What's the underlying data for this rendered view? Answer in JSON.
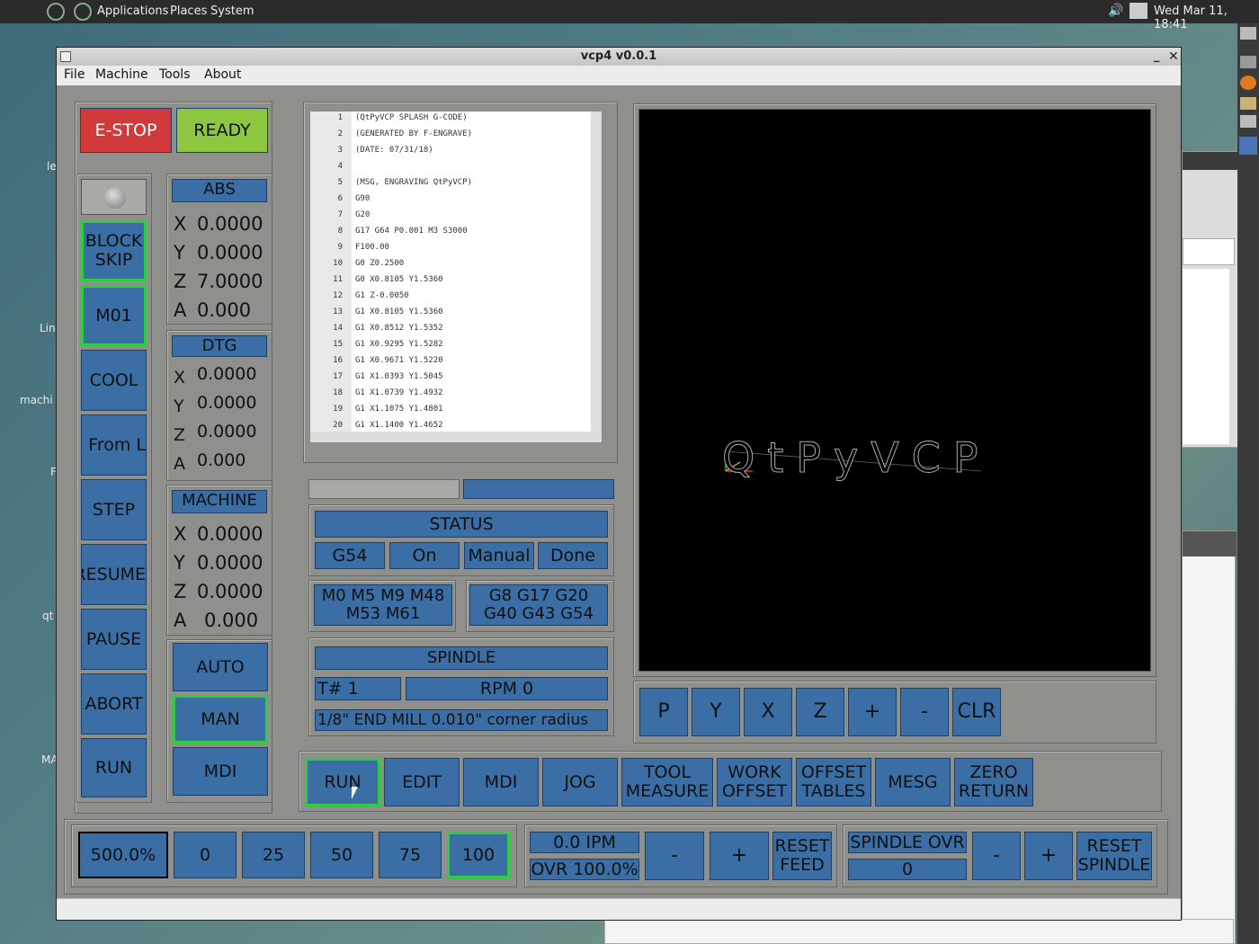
{
  "desktop": {
    "topbar": {
      "menus": [
        "Applications",
        "Places",
        "System"
      ],
      "clock": "Wed Mar 11, 18:41"
    },
    "left_labels": [
      "le",
      "Lin",
      "machi",
      "F",
      "qt",
      "MA"
    ]
  },
  "window": {
    "title": "vcp4 v0.0.1",
    "menus": [
      "File",
      "Machine",
      "Tools",
      "About"
    ]
  },
  "left_panel": {
    "estop": "E-STOP",
    "ready": "READY",
    "buttons": [
      "BLOCK\nSKIP",
      "M01",
      "COOL",
      "n From L",
      "STEP",
      "RESUME",
      "PAUSE",
      "ABORT",
      "RUN"
    ]
  },
  "dro": {
    "abs": {
      "title": "ABS",
      "rows": [
        [
          "X",
          "0.0000"
        ],
        [
          "Y",
          "0.0000"
        ],
        [
          "Z",
          "7.0000"
        ],
        [
          "A",
          "0.000"
        ]
      ]
    },
    "dtg": {
      "title": "DTG",
      "rows": [
        [
          "X",
          "0.0000"
        ],
        [
          "Y",
          "0.0000"
        ],
        [
          "Z",
          "0.0000"
        ],
        [
          "A",
          "0.000"
        ]
      ]
    },
    "machine": {
      "title": "MACHINE",
      "rows": [
        [
          "X",
          "0.0000"
        ],
        [
          "Y",
          "0.0000"
        ],
        [
          "Z",
          "0.0000"
        ],
        [
          "A",
          "0.000"
        ]
      ]
    },
    "modes": [
      "AUTO",
      "MAN",
      "MDI"
    ],
    "active_mode": "MAN"
  },
  "gcode": {
    "lines": [
      [
        "1",
        "(QtPyVCP SPLASH G-CODE)"
      ],
      [
        "2",
        "(GENERATED BY F-ENGRAVE)"
      ],
      [
        "3",
        "(DATE: 07/31/18)"
      ],
      [
        "4",
        ""
      ],
      [
        "5",
        "(MSG, ENGRAVING QtPyVCP)"
      ],
      [
        "6",
        "G90"
      ],
      [
        "7",
        "G20"
      ],
      [
        "8",
        "G17 G64 P0.001 M3 S3000"
      ],
      [
        "9",
        "F100.00"
      ],
      [
        "10",
        "G0 Z0.2500"
      ],
      [
        "11",
        "G0 X0.8105 Y1.5360"
      ],
      [
        "12",
        "G1 Z-0.0050"
      ],
      [
        "13",
        "G1 X0.8105 Y1.5360"
      ],
      [
        "14",
        "G1 X0.8512 Y1.5352"
      ],
      [
        "15",
        "G1 X0.9295 Y1.5282"
      ],
      [
        "16",
        "G1 X0.9671 Y1.5220"
      ],
      [
        "17",
        "G1 X1.0393 Y1.5045"
      ],
      [
        "18",
        "G1 X1.0739 Y1.4932"
      ],
      [
        "19",
        "G1 X1.1075 Y1.4801"
      ],
      [
        "20",
        "G1 X1.1400 Y1.4652"
      ]
    ]
  },
  "status": {
    "title": "STATUS",
    "cells": [
      "G54",
      "On",
      "Manual",
      "Done"
    ],
    "mcodes": "M0 M5 M9 M48\nM53 M61",
    "gcodes": "G8 G17 G20\nG40 G43 G54"
  },
  "spindle": {
    "title": "SPINDLE",
    "tool": "T# 1",
    "rpm": "RPM 0",
    "tool_desc": "1/8\" END MILL 0.010\" corner radius"
  },
  "preview": {
    "text": "QtPyVCP",
    "view_buttons": [
      "P",
      "Y",
      "X",
      "Z",
      "+",
      "-",
      "CLR"
    ]
  },
  "tabs": {
    "items": [
      "RUN",
      "EDIT",
      "MDI",
      "JOG",
      "TOOL\nMEASURE",
      "WORK\nOFFSET",
      "OFFSET\nTABLES",
      "MESG",
      "ZERO\nRETURN"
    ],
    "active": "RUN"
  },
  "overrides": {
    "rapid_value": "500.0%",
    "rapid_presets": [
      "0",
      "25",
      "50",
      "75",
      "100"
    ],
    "rapid_active": "100",
    "feed_ipm": "0.0  IPM",
    "feed_ovr": "OVR 100.0%",
    "feed_minus": "-",
    "feed_plus": "+",
    "reset_feed": "RESET\nFEED",
    "spindle_ovr_label": "SPINDLE OVR",
    "spindle_ovr_value": "0",
    "spindle_minus": "-",
    "spindle_plus": "+",
    "reset_spindle": "RESET\nSPINDLE"
  }
}
